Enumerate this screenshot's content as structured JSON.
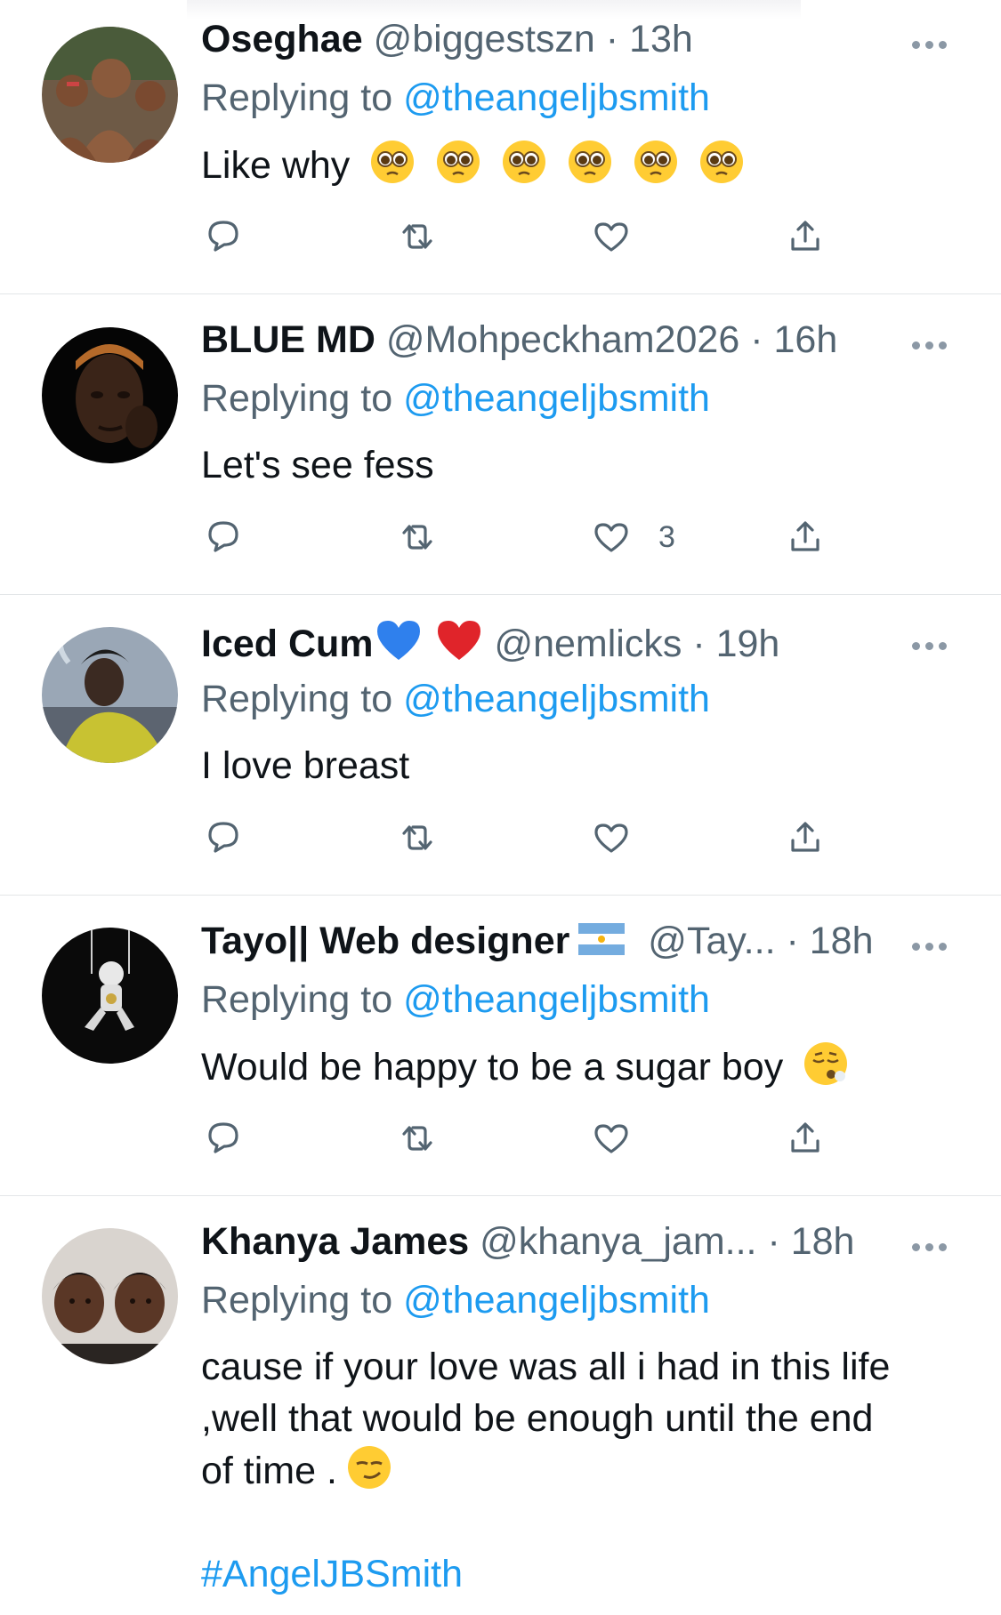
{
  "reply_label": "Replying to",
  "reply_target": "@theangeljbsmith",
  "separator": "·",
  "tweets": [
    {
      "name": "Oseghae",
      "handle": "@biggestszn",
      "time": "13h",
      "text": "Like why",
      "text_emoji": "pleading-face x6",
      "likes": ""
    },
    {
      "name": "BLUE MD",
      "handle": "@Mohpeckham2026",
      "time": "16h",
      "text": "Let's see fess",
      "likes": "3"
    },
    {
      "name": "Iced Cum",
      "name_emoji": "blue-heart red-heart",
      "handle": "@nemlicks",
      "time": "19h",
      "text": "I love breast",
      "likes": ""
    },
    {
      "name": "Tayo|| Web designer",
      "name_emoji": "argentina-flag",
      "handle": "@Tay...",
      "time": "18h",
      "text": "Would be happy to be a sugar boy",
      "text_emoji": "face-exhaling",
      "likes": ""
    },
    {
      "name": "Khanya James",
      "handle": "@khanya_jam...",
      "time": "18h",
      "text_lines": [
        "cause if your love was all i had  in this life",
        ",well  that would be enough until the end",
        "of time ."
      ],
      "text_emoji": "smirking-face",
      "hashtag": "#AngelJBSmith",
      "likes": ""
    }
  ],
  "colors": {
    "link": "#1d9bf0",
    "secondary": "#536471",
    "text": "#0f1419",
    "divider": "#e3e6e8"
  }
}
